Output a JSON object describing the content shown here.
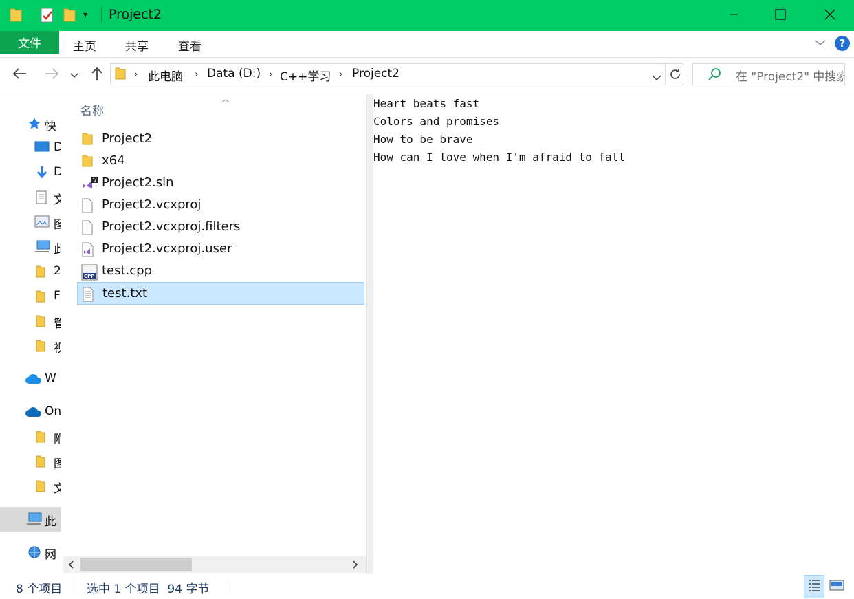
{
  "window": {
    "title": "Project2",
    "controls": {
      "minimize": "minimize-icon",
      "maximize": "maximize-icon",
      "close": "close-icon"
    }
  },
  "ribbon": {
    "tabs": [
      {
        "label": "文件",
        "active": true
      },
      {
        "label": "主页"
      },
      {
        "label": "共享"
      },
      {
        "label": "查看"
      }
    ],
    "help": "?"
  },
  "address": {
    "breadcrumb": [
      "此电脑",
      "Data (D:)",
      "C++学习",
      "Project2"
    ]
  },
  "search": {
    "placeholder": "在 \"Project2\" 中搜索"
  },
  "nav_pane": {
    "items": [
      {
        "label": "快",
        "icon": "star-icon"
      },
      {
        "label": "D",
        "icon": "desktop-icon"
      },
      {
        "label": "D",
        "icon": "download-icon"
      },
      {
        "label": "文",
        "icon": "document-icon"
      },
      {
        "label": "图",
        "icon": "picture-icon"
      },
      {
        "label": "此",
        "icon": "computer-icon"
      },
      {
        "label": "2",
        "icon": "folder-icon"
      },
      {
        "label": "F",
        "icon": "folder-icon"
      },
      {
        "label": "管",
        "icon": "folder-icon"
      },
      {
        "label": "视",
        "icon": "folder-icon"
      },
      {
        "label": "W",
        "icon": "cloud-icon"
      },
      {
        "label": "On",
        "icon": "onedrive-icon"
      },
      {
        "label": "附",
        "icon": "folder-icon"
      },
      {
        "label": "图",
        "icon": "folder-icon"
      },
      {
        "label": "文",
        "icon": "folder-icon"
      },
      {
        "label": "此",
        "icon": "computer-icon",
        "selected": true
      },
      {
        "label": "网",
        "icon": "network-icon"
      }
    ]
  },
  "file_list": {
    "column_header": "名称",
    "files": [
      {
        "name": "Project2",
        "icon": "folder-icon"
      },
      {
        "name": "x64",
        "icon": "folder-icon"
      },
      {
        "name": "Project2.sln",
        "icon": "vs-solution-icon"
      },
      {
        "name": "Project2.vcxproj",
        "icon": "blank-file-icon"
      },
      {
        "name": "Project2.vcxproj.filters",
        "icon": "blank-file-icon"
      },
      {
        "name": "Project2.vcxproj.user",
        "icon": "vs-user-icon"
      },
      {
        "name": "test.cpp",
        "icon": "cpp-file-icon"
      },
      {
        "name": "test.txt",
        "icon": "text-file-icon",
        "selected": true
      }
    ]
  },
  "preview": {
    "lines": [
      "Heart beats fast",
      "Colors and promises",
      "How to be brave",
      "How can I love when I'm afraid to fall"
    ]
  },
  "status_bar": {
    "item_count": "8 个项目",
    "selection": "选中 1 个项目  94 字节"
  },
  "colors": {
    "titlebar": "#00cc66",
    "file_tab": "#0aa34f",
    "selection": "#cce8ff",
    "folder": "#f7c948"
  }
}
